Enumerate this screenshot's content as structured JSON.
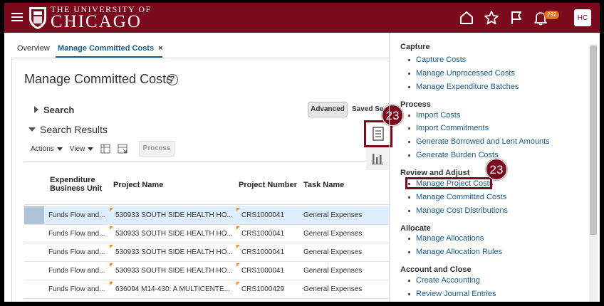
{
  "header": {
    "brand_top": "THE UNIVERSITY OF",
    "brand_main": "CHICAGO",
    "notification_count": "292",
    "user_initials": "HC",
    "icons": [
      "menu-icon",
      "home-icon",
      "star-icon",
      "flag-icon",
      "bell-icon"
    ]
  },
  "tabs": {
    "overview": "Overview",
    "active": "Manage Committed Costs",
    "close": "×"
  },
  "page": {
    "title": "Manage Committed Costs",
    "help": "?"
  },
  "search": {
    "label": "Search",
    "advanced": "Advanced",
    "saved": "Saved Se"
  },
  "results": {
    "label": "Search Results",
    "actions": "Actions",
    "view": "View",
    "process": "Process"
  },
  "table": {
    "headers": {
      "unit_line1": "Expenditure",
      "unit_line2": "Business Unit",
      "project_name": "Project Name",
      "project_number": "Project Number",
      "task_name": "Task Name"
    },
    "rows": [
      {
        "unit": "Funds Flow and...",
        "project": "530933 SOUTH SIDE HEALTH HO...",
        "number": "CRS1000041",
        "task": "General Expenses"
      },
      {
        "unit": "Funds Flow and...",
        "project": "530933 SOUTH SIDE HEALTH HO...",
        "number": "CRS1000041",
        "task": "General Expenses"
      },
      {
        "unit": "Funds Flow and...",
        "project": "530933 SOUTH SIDE HEALTH HO...",
        "number": "CRS1000041",
        "task": "General Expenses"
      },
      {
        "unit": "Funds Flow and...",
        "project": "530933 SOUTH SIDE HEALTH HO...",
        "number": "CRS1000041",
        "task": "General Expenses"
      },
      {
        "unit": "Funds Flow and...",
        "project": "636094 M14-430: A MULTICENTE...",
        "number": "CRS1000429",
        "task": "General Expenses"
      }
    ]
  },
  "callouts": {
    "first": "23",
    "second": "23"
  },
  "tasks": {
    "capture": {
      "title": "Capture",
      "items": [
        "Capture Costs",
        "Manage Unprocessed Costs",
        "Manage Expenditure Batches"
      ]
    },
    "process": {
      "title": "Process",
      "items": [
        "Import Costs",
        "Import Commitments",
        "Generate Borrowed and Lent Amounts",
        "Generate Burden Costs"
      ]
    },
    "review": {
      "title": "Review and Adjust",
      "items": [
        "Manage Project Costs",
        "Manage Committed Costs",
        "Manage Cost Distributions"
      ]
    },
    "allocate": {
      "title": "Allocate",
      "items": [
        "Manage Allocations",
        "Manage Allocation Rules"
      ]
    },
    "account": {
      "title": "Account and Close",
      "items": [
        "Create Accounting",
        "Review Journal Entries"
      ]
    }
  },
  "colors": {
    "brand": "#7a0a1c",
    "link": "#1a5a8a",
    "badge": "#e8701a",
    "selected_row": "#ddeeff"
  }
}
